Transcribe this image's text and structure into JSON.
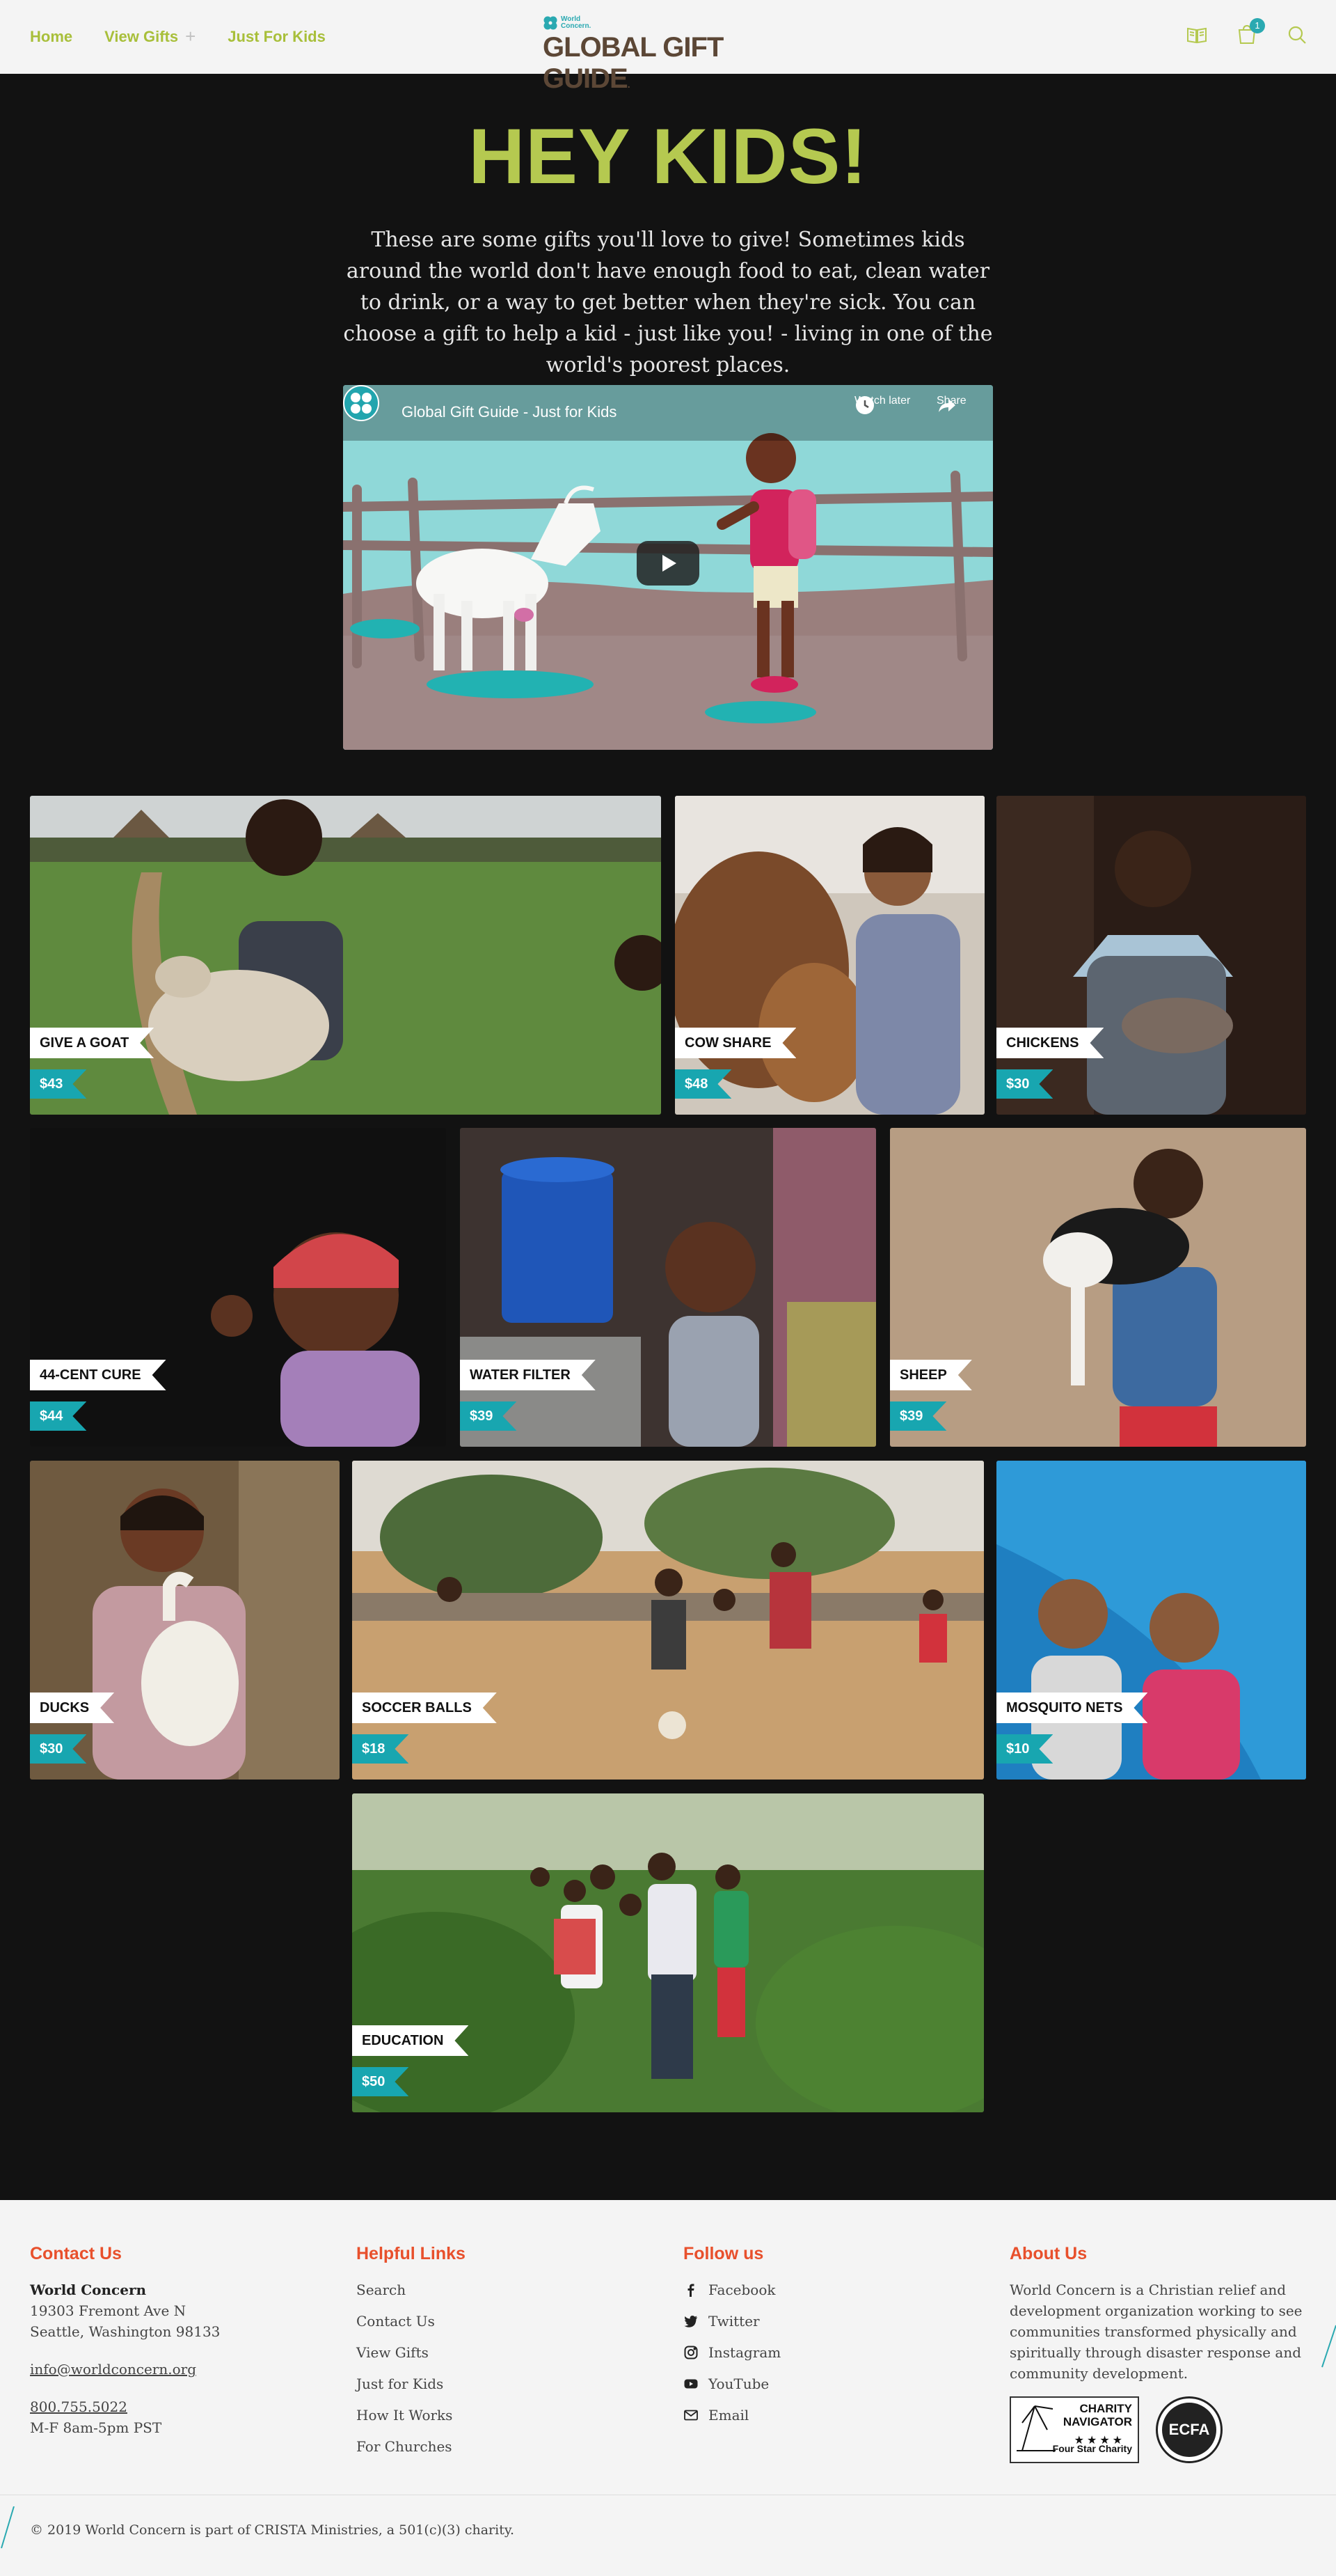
{
  "header": {
    "nav": [
      {
        "label": "Home"
      },
      {
        "label": "View Gifts",
        "has_submenu": true
      },
      {
        "label": "Just For Kids"
      }
    ],
    "logo": {
      "brand_line1": "World",
      "brand_line2": "Concern.",
      "title": "GLOBAL GIFT GUIDE",
      "trademark": "."
    },
    "icons": [
      {
        "name": "book-icon"
      },
      {
        "name": "cart-icon",
        "badge": "1"
      },
      {
        "name": "search-icon"
      }
    ],
    "accent_color": "#a8bf3a"
  },
  "hero": {
    "title": "HEY KIDS!",
    "intro": "These are some gifts you'll love to give! Sometimes kids around the world don't have enough food to eat, clean water to drink, or a way to get better when they're sick. You can choose a gift to help a kid - just like you! - living in one of the world's poorest places."
  },
  "video": {
    "title": "Global Gift Guide - Just for Kids",
    "watch_later": "Watch later",
    "share": "Share"
  },
  "gifts": [
    {
      "name": "GIVE A GOAT",
      "price": "$43"
    },
    {
      "name": "COW SHARE",
      "price": "$48"
    },
    {
      "name": "CHICKENS",
      "price": "$30"
    },
    {
      "name": "44-CENT CURE",
      "price": "$44"
    },
    {
      "name": "WATER FILTER",
      "price": "$39"
    },
    {
      "name": "SHEEP",
      "price": "$39"
    },
    {
      "name": "DUCKS",
      "price": "$30"
    },
    {
      "name": "SOCCER BALLS",
      "price": "$18"
    },
    {
      "name": "MOSQUITO NETS",
      "price": "$10"
    },
    {
      "name": "EDUCATION",
      "price": "$50"
    }
  ],
  "footer": {
    "contact": {
      "heading": "Contact Us",
      "org": "World Concern",
      "address1": "19303 Fremont Ave N",
      "address2": "Seattle, Washington 98133",
      "email": "info@worldconcern.org",
      "phone": "800.755.5022",
      "hours": "M-F 8am-5pm PST"
    },
    "links": {
      "heading": "Helpful Links",
      "items": [
        "Search",
        "Contact Us",
        "View Gifts",
        "Just for Kids",
        "How It Works",
        "For Churches"
      ]
    },
    "follow": {
      "heading": "Follow us",
      "items": [
        {
          "label": "Facebook",
          "icon": "facebook-icon"
        },
        {
          "label": "Twitter",
          "icon": "twitter-icon"
        },
        {
          "label": "Instagram",
          "icon": "instagram-icon"
        },
        {
          "label": "YouTube",
          "icon": "youtube-icon"
        },
        {
          "label": "Email",
          "icon": "email-icon"
        }
      ]
    },
    "about": {
      "heading": "About Us",
      "text": "World Concern is a Christian relief and development organization working to see communities transformed physically and spiritually through disaster response and community development.",
      "charity_navigator": {
        "line1": "CHARITY",
        "line2": "NAVIGATOR",
        "stars": "★★★★",
        "sub": "Four Star Charity"
      },
      "ecfa": "ECFA"
    },
    "copyright": "© 2019 World Concern is part of CRISTA Ministries, a 501(c)(3) charity.",
    "heading_color": "#e8502c"
  }
}
